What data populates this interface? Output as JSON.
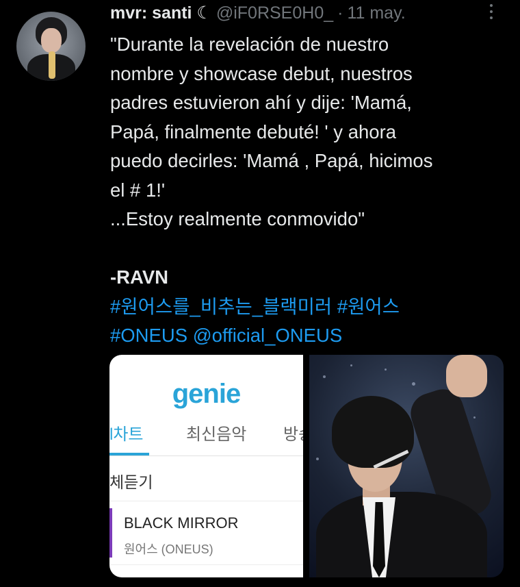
{
  "tweet": {
    "display_name": "mvr: santi ☾",
    "handle": "@iF0RSE0H0_",
    "separator": "·",
    "date": "11 may.",
    "lines": [
      "\"Durante la revelación de nuestro",
      "nombre y showcase debut, nuestros",
      "padres estuvieron ahí y dije: 'Mamá,",
      "Papá, finalmente debuté! ' y ahora",
      "puedo decirles: 'Mamá , Papá, hicimos",
      "el # 1!'",
      "...Estoy realmente conmovido\""
    ],
    "signature": "-RAVN",
    "hashtag_1": "#원어스를_비추는_블랙미러",
    "hashtag_2": "#원어스",
    "hashtag_3": "#ONEUS",
    "mention": "@official_ONEUS"
  },
  "media": {
    "left_screenshot": {
      "logo": "genie",
      "tabs": [
        "l차트",
        "최신음악",
        "방송"
      ],
      "active_tab": 0,
      "listen_all": "체듣기",
      "song_title": "BLACK MIRROR",
      "song_artist": "원어스 (ONEUS)"
    }
  },
  "colors": {
    "background": "#000000",
    "text": "#e7e9ea",
    "muted": "#71767b",
    "link": "#1d9bf0",
    "genie_blue": "#2aa4d8",
    "song_accent": "#7b3bb8"
  },
  "icons": {
    "more": "more-vertical-icon"
  }
}
